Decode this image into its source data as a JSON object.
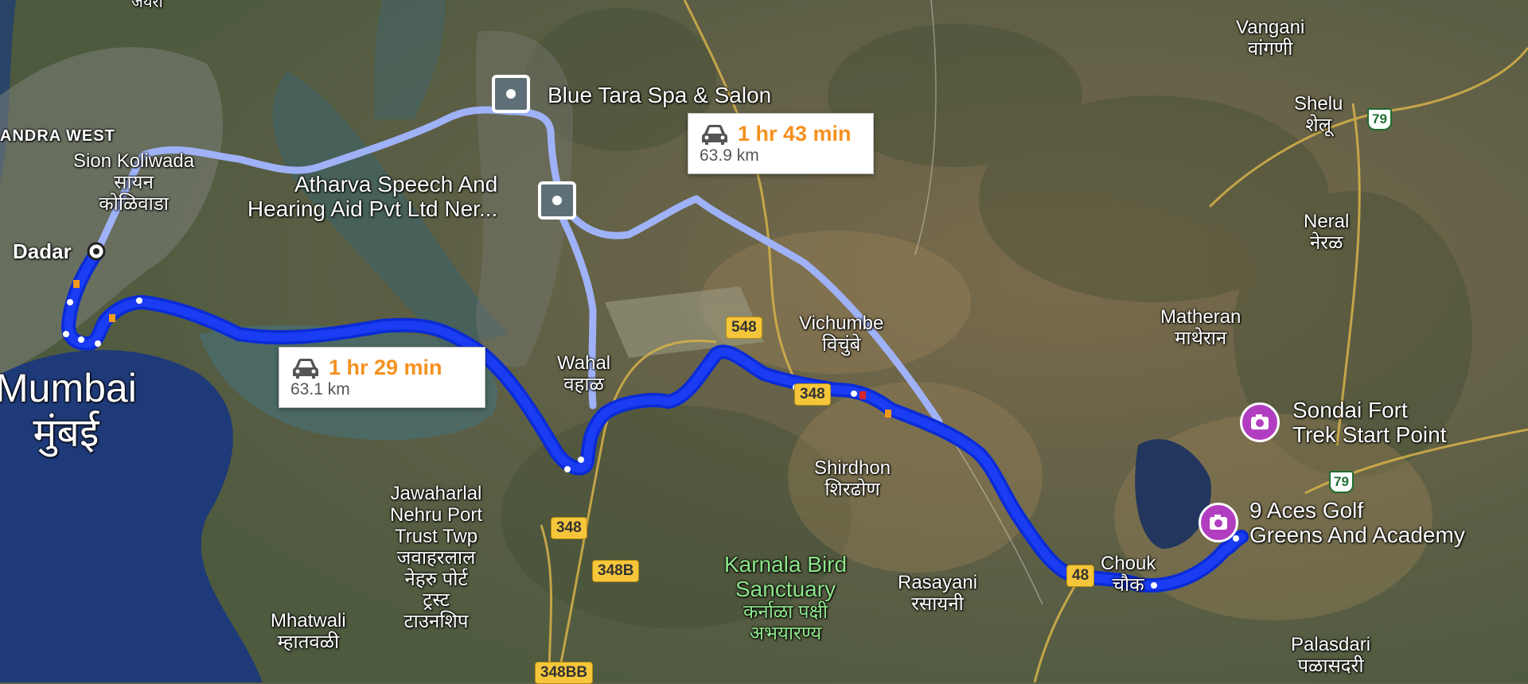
{
  "routes": {
    "primary": {
      "time": "1 hr 29 min",
      "distance": "63.1 km",
      "color": "#1a3cf2"
    },
    "alternate": {
      "time": "1 hr 43 min",
      "distance": "63.9 km",
      "color": "#9fb2f7"
    }
  },
  "origin": {
    "label": "Dadar"
  },
  "places": {
    "bandra": "ANDRA WEST",
    "jambhul_top": "जयरा",
    "sion_en": "Sion Koliwada",
    "sion_hi1": "सायन",
    "sion_hi2": "कोळिवाडा",
    "mumbai_en": "Mumbai",
    "mumbai_hi": "मुंबई",
    "wahal_en": "Wahal",
    "wahal_hi": "वहाळ",
    "jnpt_en1": "Jawaharlal",
    "jnpt_en2": "Nehru Port",
    "jnpt_en3": "Trust Twp",
    "jnpt_hi1": "जवाहरलाल",
    "jnpt_hi2": "नेहरु पोर्ट",
    "jnpt_hi3": "ट्रस्ट",
    "jnpt_hi4": "टाउनशिप",
    "mhatwali_en": "Mhatwali",
    "mhatwali_hi": "म्हातवळी",
    "vichumbe_en": "Vichumbe",
    "vichumbe_hi": "विचुंबे",
    "shirdhon_en": "Shirdhon",
    "shirdhon_hi": "शिरढोण",
    "karnala_en1": "Karnala Bird",
    "karnala_en2": "Sanctuary",
    "karnala_hi1": "कर्नाळा पक्षी",
    "karnala_hi2": "अभयारण्य",
    "rasayani_en": "Rasayani",
    "rasayani_hi": "रसायनी",
    "chouk_en": "Chouk",
    "chouk_hi": "चौक",
    "vangani_en": "Vangani",
    "vangani_hi": "वांगणी",
    "shelu_en": "Shelu",
    "shelu_hi": "शेलू",
    "neral_en": "Neral",
    "neral_hi": "नेरळ",
    "matheran_en": "Matheran",
    "matheran_hi": "माथेरान",
    "palasdari_en": "Palasdari",
    "palasdari_hi": "पळासदरी"
  },
  "pois": {
    "blue_tara": "Blue Tara Spa & Salon",
    "atharva1": "Atharva Speech And",
    "atharva2": "Hearing Aid Pvt Ltd Ner...",
    "sondai1": "Sondai Fort",
    "sondai2": "Trek Start Point",
    "aces1": "9 Aces Golf",
    "aces2": "Greens And Academy"
  },
  "shields": {
    "s548": "548",
    "s348a": "348",
    "s348b": "348",
    "s348B": "348B",
    "s348BB": "348BB",
    "s48": "48",
    "s79a": "79",
    "s79b": "79",
    "s548top": "548"
  },
  "icons": {
    "car": "car-icon",
    "pin": "photo-pin-icon",
    "poi": "place-square-icon"
  }
}
